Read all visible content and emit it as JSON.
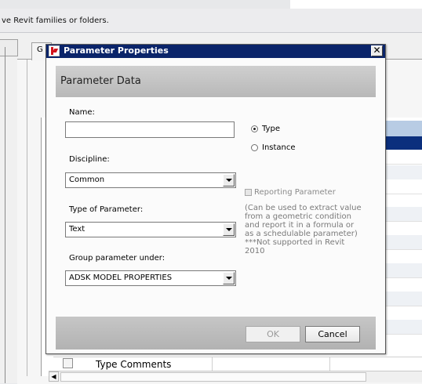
{
  "background": {
    "header_text": "ve Revit families or folders.",
    "tab_label": "G",
    "bottom_row_label": "Type Comments"
  },
  "dialog": {
    "title": "Parameter Properties",
    "close_glyph": "✕",
    "section_title": "Parameter Data",
    "name_label": "Name:",
    "name_value": "",
    "discipline_label": "Discipline:",
    "discipline_value": "Common",
    "type_label": "Type of Parameter:",
    "type_value": "Text",
    "group_label": "Group parameter under:",
    "group_value": "ADSK MODEL PROPERTIES",
    "radio_type_label": "Type",
    "radio_instance_label": "Instance",
    "radio_selected": "Type",
    "reporting_label": "Reporting Parameter",
    "reporting_help": "(Can be used to extract value from a geometric condition and report it in a formula or as a schedulable parameter) ***Not supported in Revit 2010",
    "ok_label": "OK",
    "cancel_label": "Cancel"
  },
  "colors": {
    "titlebar": "#0a246a",
    "selection": "#0b2f7d",
    "highlight": "#b8cce4"
  }
}
